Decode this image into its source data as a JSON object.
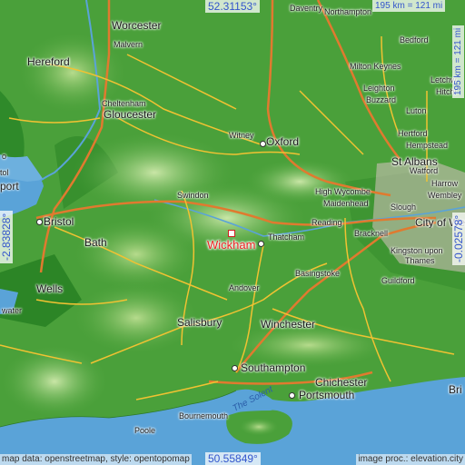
{
  "marker": {
    "label": "Wickham",
    "color": "#e22222"
  },
  "coordinates": {
    "north": "52.31153°",
    "south": "50.55849°",
    "west": "-2.83828°",
    "east": "-0.02578°"
  },
  "scale": {
    "horizontal": "195 km = 121 mi",
    "vertical": "195 km = 121 mi"
  },
  "attribution": {
    "left": "map data: openstreetmap, style: opentopomap",
    "right": "image proc.: elevation.city"
  },
  "places": [
    {
      "name": "Daventry",
      "size": "small"
    },
    {
      "name": "Northampton",
      "size": "small"
    },
    {
      "name": "Worcester",
      "size": "large"
    },
    {
      "name": "Malvern",
      "size": "small"
    },
    {
      "name": "Bedford",
      "size": "small"
    },
    {
      "name": "Hereford",
      "size": "large"
    },
    {
      "name": "Milton Keynes",
      "size": "small"
    },
    {
      "name": "Leighton",
      "size": "small"
    },
    {
      "name": "Buzzard",
      "size": "small"
    },
    {
      "name": "Letchw",
      "size": "small"
    },
    {
      "name": "Hitchi",
      "size": "small"
    },
    {
      "name": "Cheltenham",
      "size": "small"
    },
    {
      "name": "Gloucester",
      "size": "large"
    },
    {
      "name": "Luton",
      "size": "small"
    },
    {
      "name": "Hertford",
      "size": "small"
    },
    {
      "name": "Hempstead",
      "size": "small"
    },
    {
      "name": "Witney",
      "size": "small"
    },
    {
      "name": "Oxford",
      "size": "large"
    },
    {
      "name": "St Albans",
      "size": "large"
    },
    {
      "name": "Watford",
      "size": "small"
    },
    {
      "name": "Harrow",
      "size": "small"
    },
    {
      "name": "High Wycombe",
      "size": "small"
    },
    {
      "name": "Wembley",
      "size": "small"
    },
    {
      "name": "Swindon",
      "size": "small"
    },
    {
      "name": "Maidenhead",
      "size": "small"
    },
    {
      "name": "Slough",
      "size": "small"
    },
    {
      "name": "City of Westminster",
      "size": "large"
    },
    {
      "name": "Bristol",
      "size": "large"
    },
    {
      "name": "Reading",
      "size": "small"
    },
    {
      "name": "Bath",
      "size": "large"
    },
    {
      "name": "Thatcham",
      "size": "small"
    },
    {
      "name": "Bracknell",
      "size": "small"
    },
    {
      "name": "Kingston upon",
      "size": "small"
    },
    {
      "name": "Thames",
      "size": "small"
    },
    {
      "name": "Basingstoke",
      "size": "small"
    },
    {
      "name": "Wells",
      "size": "large"
    },
    {
      "name": "Guildford",
      "size": "small"
    },
    {
      "name": "Andover",
      "size": "small"
    },
    {
      "name": "water",
      "size": "small"
    },
    {
      "name": "Salisbury",
      "size": "large"
    },
    {
      "name": "Winchester",
      "size": "large"
    },
    {
      "name": "Southampton",
      "size": "large"
    },
    {
      "name": "Chichester",
      "size": "large"
    },
    {
      "name": "Portsmouth",
      "size": "large"
    },
    {
      "name": "Bri",
      "size": "large"
    },
    {
      "name": "Bournemouth",
      "size": "small"
    },
    {
      "name": "Poole",
      "size": "small"
    },
    {
      "name": "port",
      "size": "large"
    },
    {
      "name": "tol",
      "size": "small"
    },
    {
      "name": "o",
      "size": "small"
    }
  ],
  "water_labels": [
    "The Solent"
  ],
  "colors": {
    "land_low": "#3c8f2e",
    "land_high": "#9fcd7a",
    "sea": "#5aa3d8",
    "road": "#f1c232",
    "motorway": "#e07a2f",
    "coord_text": "#3355cc"
  }
}
